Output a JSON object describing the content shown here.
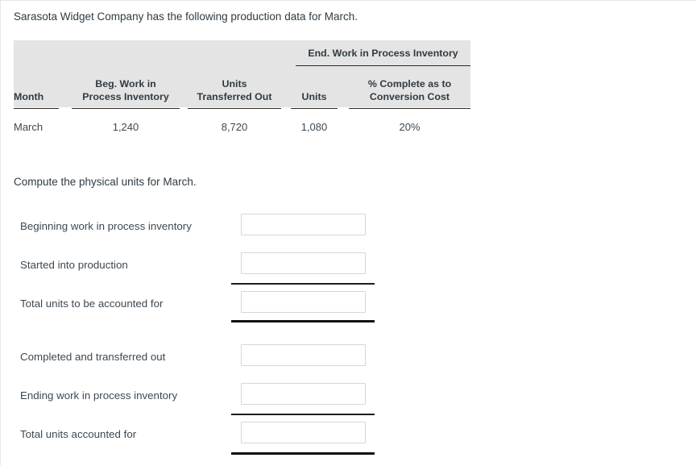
{
  "intro": {
    "text": "Sarasota Widget Company has the following production data for March."
  },
  "table": {
    "span_header": "End. Work in Process Inventory",
    "columns": [
      "Month",
      "Beg. Work in Process Inventory",
      "Units Transferred Out",
      "Units",
      "% Complete as to Conversion Cost"
    ],
    "columns_lines": [
      [
        "Month"
      ],
      [
        "Beg. Work in",
        "Process Inventory"
      ],
      [
        "Units",
        "Transferred Out"
      ],
      [
        "Units"
      ],
      [
        "% Complete as to",
        "Conversion Cost"
      ]
    ],
    "rows": [
      {
        "month": "March",
        "beg_wip": "1,240",
        "units_transferred_out": "8,720",
        "end_wip_units": "1,080",
        "end_wip_pct_conversion": "20%"
      }
    ]
  },
  "prompt": {
    "text": "Compute the physical units for March."
  },
  "form": {
    "group_one": [
      {
        "label": "Beginning work in process inventory",
        "value": "",
        "placeholder": ""
      },
      {
        "label": "Started into production",
        "value": "",
        "placeholder": ""
      },
      {
        "label": "Total units to be accounted for",
        "value": "",
        "placeholder": ""
      }
    ],
    "group_two": [
      {
        "label": "Completed and transferred out",
        "value": "",
        "placeholder": ""
      },
      {
        "label": "Ending work in process inventory",
        "value": "",
        "placeholder": ""
      },
      {
        "label": "Total units accounted for",
        "value": "",
        "placeholder": ""
      }
    ]
  },
  "colors": {
    "header_bg": "#e4e4e4",
    "text": "#3d4852",
    "rule": "#1d1d1d",
    "input_border": "#d5d7d8"
  }
}
